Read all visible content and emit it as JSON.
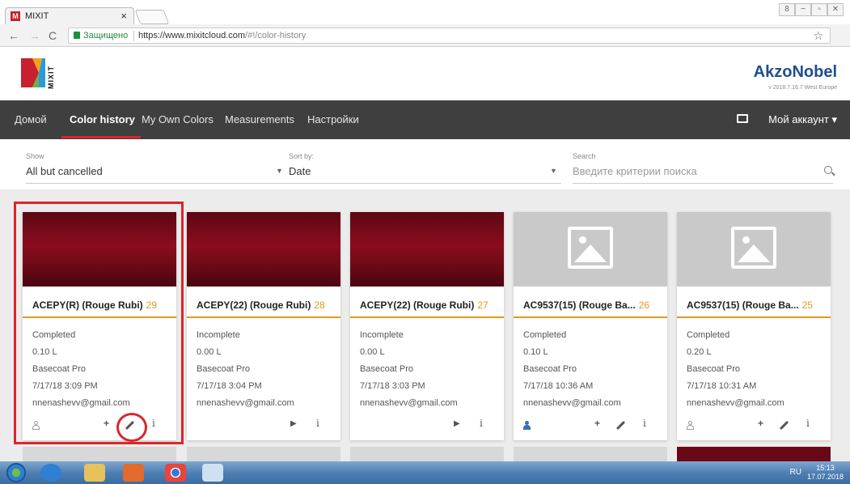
{
  "browser": {
    "tab_title": "MIXIT",
    "tab_favicon": "M",
    "close_glyph": "×",
    "secure_label": "Защищено",
    "url_base": "https://www.mixitcloud.com",
    "url_path": "/#!/color-history",
    "star_glyph": "☆",
    "win_buttons": [
      "8",
      "−",
      "▫",
      "✕"
    ]
  },
  "header": {
    "logo_text": "MIXIT",
    "brand": "AkzoNobel",
    "version": "v 2018.7.16.7 West Europe"
  },
  "nav": {
    "items": [
      "Домой",
      "Color history",
      "My Own Colors",
      "Measurements",
      "Настройки"
    ],
    "active_index": 1,
    "account": "Мой аккаунт ▾"
  },
  "filters": {
    "show_label": "Show",
    "show_value": "All but cancelled",
    "sort_label": "Sort by:",
    "sort_value": "Date",
    "search_label": "Search",
    "search_placeholder": "Введите критерии поиска"
  },
  "cards": [
    {
      "title": "ACEPY(R) (Rouge Rubi)",
      "number": "29",
      "image": "swatch",
      "status": "Completed",
      "volume": "0.10 L",
      "product": "Basecoat Pro",
      "datetime": "7/17/18 3:09 PM",
      "user": "nnenashevv@gmail.com",
      "actions": [
        "user",
        "plus",
        "brush",
        "info"
      ],
      "user_filled": false
    },
    {
      "title": "ACEPY(22) (Rouge Rubi)",
      "number": "28",
      "image": "swatch",
      "status": "Incomplete",
      "volume": "0.00 L",
      "product": "Basecoat Pro",
      "datetime": "7/17/18 3:04 PM",
      "user": "nnenashevv@gmail.com",
      "actions": [
        "play",
        "info"
      ],
      "user_filled": false
    },
    {
      "title": "ACEPY(22) (Rouge Rubi)",
      "number": "27",
      "image": "swatch",
      "status": "Incomplete",
      "volume": "0.00 L",
      "product": "Basecoat Pro",
      "datetime": "7/17/18 3:03 PM",
      "user": "nnenashevv@gmail.com",
      "actions": [
        "play",
        "info"
      ],
      "user_filled": false
    },
    {
      "title": "AC9537(15) (Rouge Ba...",
      "number": "26",
      "image": "placeholder",
      "status": "Completed",
      "volume": "0.10 L",
      "product": "Basecoat Pro",
      "datetime": "7/17/18 10:36 AM",
      "user": "nnenashevv@gmail.com",
      "actions": [
        "user",
        "plus",
        "brush",
        "info"
      ],
      "user_filled": true
    },
    {
      "title": "AC9537(15) (Rouge Ba...",
      "number": "25",
      "image": "placeholder",
      "status": "Completed",
      "volume": "0.20 L",
      "product": "Basecoat Pro",
      "datetime": "7/17/18 10:31 AM",
      "user": "nnenashevv@gmail.com",
      "actions": [
        "user",
        "plus",
        "brush",
        "info"
      ],
      "user_filled": false
    }
  ],
  "taskbar": {
    "lang": "RU",
    "time": "15:13",
    "date": "17.07.2018"
  },
  "colors": {
    "accent_orange": "#e8971c",
    "highlight_red": "#d9262c",
    "nav_bg": "#3f3f3f",
    "brand_blue": "#1f4e8c"
  }
}
